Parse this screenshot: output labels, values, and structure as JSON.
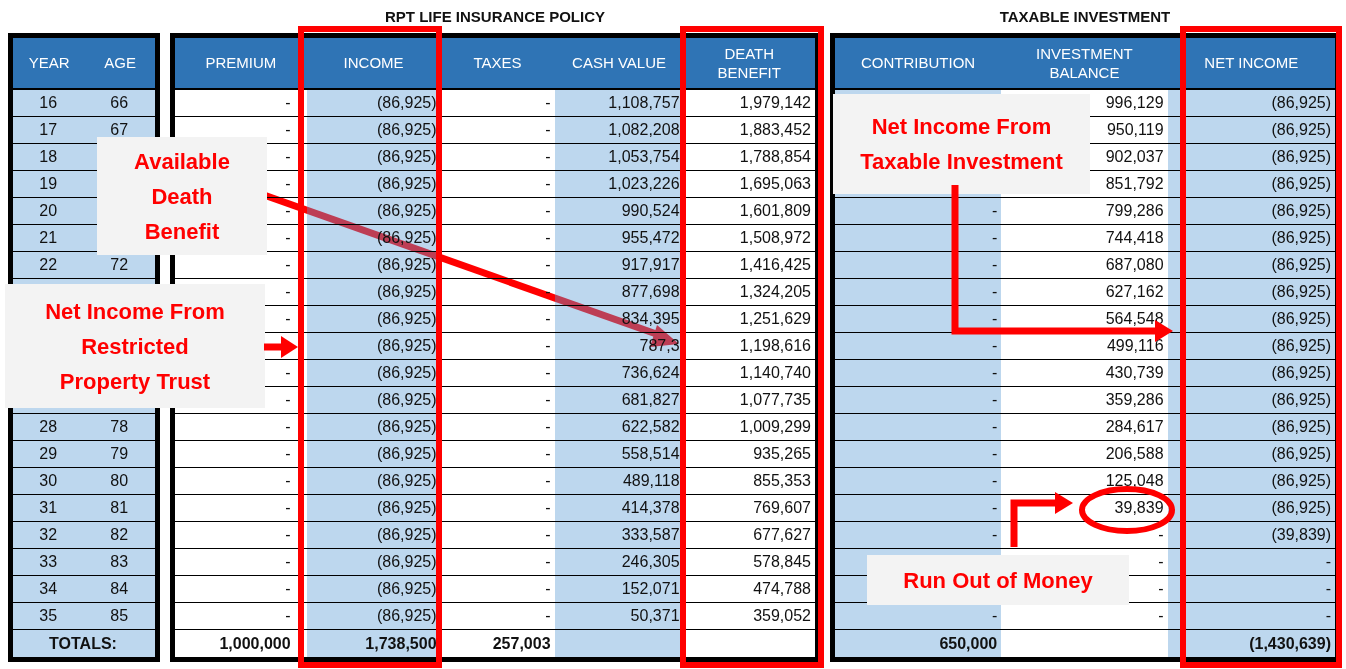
{
  "sections": [
    {
      "title": "RPT LIFE INSURANCE POLICY"
    },
    {
      "title": "TAXABLE INVESTMENT"
    }
  ],
  "tables": [
    {
      "columns": [
        {
          "lines": [
            "YEAR"
          ]
        },
        {
          "lines": [
            "AGE"
          ]
        }
      ],
      "rows": [
        {
          "year": "16",
          "age": "66"
        },
        {
          "year": "17",
          "age": "67"
        },
        {
          "year": "18"
        },
        {
          "year": "19"
        },
        {
          "year": "20"
        },
        {
          "year": "21"
        },
        {
          "year": "22",
          "age": "72"
        },
        {},
        {},
        {},
        {},
        {},
        {
          "year": "28",
          "age": "78"
        },
        {
          "year": "29",
          "age": "79"
        },
        {
          "year": "30",
          "age": "80"
        },
        {
          "year": "31",
          "age": "81"
        },
        {
          "year": "32",
          "age": "82"
        },
        {
          "year": "33",
          "age": "83"
        },
        {
          "year": "34",
          "age": "84"
        },
        {
          "year": "35",
          "age": "85"
        }
      ],
      "totals": {
        "label": "TOTALS:"
      }
    },
    {
      "columns": [
        {
          "lines": [
            "PREMIUM"
          ]
        },
        {
          "lines": [
            "INCOME"
          ]
        },
        {
          "lines": [
            "TAXES"
          ]
        },
        {
          "lines": [
            "CASH VALUE"
          ]
        },
        {
          "lines": [
            "DEATH",
            "BENEFIT"
          ]
        }
      ],
      "rows": [
        {
          "premium": "-",
          "income": "(86,925)",
          "taxes": "-",
          "cash_value": "1,108,757",
          "death_benefit": "1,979,142"
        },
        {
          "premium": "-",
          "income": "(86,925)",
          "taxes": "-",
          "cash_value": "1,082,208",
          "death_benefit": "1,883,452"
        },
        {
          "premium": "-",
          "income": "(86,925)",
          "taxes": "-",
          "cash_value": "1,053,754",
          "death_benefit": "1,788,854"
        },
        {
          "premium": "-",
          "income": "(86,925)",
          "taxes": "-",
          "cash_value": "1,023,226",
          "death_benefit": "1,695,063"
        },
        {
          "premium": "-",
          "income": "(86,925)",
          "taxes": "-",
          "cash_value": "990,524",
          "death_benefit": "1,601,809"
        },
        {
          "premium": "-",
          "income": "(86,925)",
          "taxes": "-",
          "cash_value": "955,472",
          "death_benefit": "1,508,972"
        },
        {
          "premium": "-",
          "income": "(86,925)",
          "taxes": "-",
          "cash_value": "917,917",
          "death_benefit": "1,416,425"
        },
        {
          "premium": "-",
          "income": "(86,925)",
          "taxes": "-",
          "cash_value": "877,698",
          "death_benefit": "1,324,205"
        },
        {
          "premium": "-",
          "income": "(86,925)",
          "taxes": "-",
          "cash_value": "834,395",
          "death_benefit": "1,251,629"
        },
        {
          "income": "(86,925)",
          "taxes": "-",
          "cash_value": "787,3",
          "death_benefit": "1,198,616"
        },
        {
          "premium": "-",
          "income": "(86,925)",
          "taxes": "-",
          "cash_value": "736,624",
          "death_benefit": "1,140,740"
        },
        {
          "premium": "-",
          "income": "(86,925)",
          "taxes": "-",
          "cash_value": "681,827",
          "death_benefit": "1,077,735"
        },
        {
          "premium": "-",
          "income": "(86,925)",
          "taxes": "-",
          "cash_value": "622,582",
          "death_benefit": "1,009,299"
        },
        {
          "premium": "-",
          "income": "(86,925)",
          "taxes": "-",
          "cash_value": "558,514",
          "death_benefit": "935,265"
        },
        {
          "premium": "-",
          "income": "(86,925)",
          "taxes": "-",
          "cash_value": "489,118",
          "death_benefit": "855,353"
        },
        {
          "premium": "-",
          "income": "(86,925)",
          "taxes": "-",
          "cash_value": "414,378",
          "death_benefit": "769,607"
        },
        {
          "premium": "-",
          "income": "(86,925)",
          "taxes": "-",
          "cash_value": "333,587",
          "death_benefit": "677,627"
        },
        {
          "premium": "-",
          "income": "(86,925)",
          "taxes": "-",
          "cash_value": "246,305",
          "death_benefit": "578,845"
        },
        {
          "premium": "-",
          "income": "(86,925)",
          "taxes": "-",
          "cash_value": "152,071",
          "death_benefit": "474,788"
        },
        {
          "premium": "-",
          "income": "(86,925)",
          "taxes": "-",
          "cash_value": "50,371",
          "death_benefit": "359,052"
        }
      ],
      "totals": {
        "premium": "1,000,000",
        "income": "1,738,500",
        "taxes": "257,003"
      }
    },
    {
      "columns": [
        {
          "lines": [
            "CONTRIBUTION"
          ]
        },
        {
          "lines": [
            "INVESTMENT",
            "BALANCE"
          ]
        },
        {
          "lines": [
            "NET INCOME"
          ]
        }
      ],
      "rows": [
        {
          "investment_balance": "996,129",
          "net_income": "(86,925)"
        },
        {
          "investment_balance": "950,119",
          "net_income": "(86,925)"
        },
        {
          "investment_balance": "902,037",
          "net_income": "(86,925)"
        },
        {
          "investment_balance": "851,792",
          "net_income": "(86,925)"
        },
        {
          "contribution": "-",
          "investment_balance": "799,286",
          "net_income": "(86,925)"
        },
        {
          "contribution": "-",
          "investment_balance": "744,418",
          "net_income": "(86,925)"
        },
        {
          "contribution": "-",
          "investment_balance": "687,080",
          "net_income": "(86,925)"
        },
        {
          "contribution": "-",
          "investment_balance": "627,162",
          "net_income": "(86,925)"
        },
        {
          "contribution": "-",
          "investment_balance": "564,548",
          "net_income": "(86,925)"
        },
        {
          "contribution": "-",
          "investment_balance": "499,116",
          "net_income": "(86,925)"
        },
        {
          "contribution": "-",
          "investment_balance": "430,739",
          "net_income": "(86,925)"
        },
        {
          "contribution": "-",
          "investment_balance": "359,286",
          "net_income": "(86,925)"
        },
        {
          "contribution": "-",
          "investment_balance": "284,617",
          "net_income": "(86,925)"
        },
        {
          "contribution": "-",
          "investment_balance": "206,588",
          "net_income": "(86,925)"
        },
        {
          "contribution": "-",
          "investment_balance": "125,048",
          "net_income": "(86,925)"
        },
        {
          "contribution": "-",
          "investment_balance": "39,839",
          "net_income": "(86,925)"
        },
        {
          "contribution": "-",
          "investment_balance": "-",
          "net_income": "(39,839)"
        },
        {
          "investment_balance": "-",
          "net_income": "-"
        },
        {
          "investment_balance": "-",
          "net_income": "-"
        },
        {
          "contribution": "-",
          "investment_balance": "-",
          "net_income": "-"
        }
      ],
      "totals": {
        "contribution": "650,000",
        "net_income": "(1,430,639)"
      }
    }
  ],
  "annotations": [
    {
      "lines": [
        "Available",
        "Death",
        "Benefit"
      ]
    },
    {
      "lines": [
        "Net Income From",
        "Restricted",
        "Property Trust"
      ]
    },
    {
      "lines": [
        "Net Income From",
        "Taxable Investment"
      ]
    },
    {
      "lines": [
        "Run Out of Money"
      ]
    }
  ]
}
